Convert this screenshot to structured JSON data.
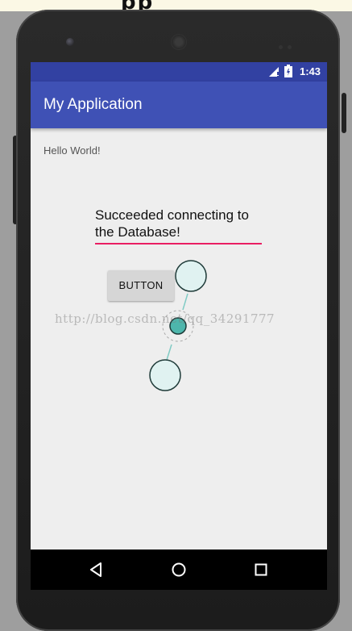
{
  "status_bar": {
    "time": "1:43",
    "icons": [
      "signal-icon",
      "battery-icon"
    ]
  },
  "app_bar": {
    "title": "My Application"
  },
  "content": {
    "hello_text": "Hello World!",
    "edit_text_value": "Succeeded connecting to the Database!",
    "button_label": "BUTTON"
  },
  "watermark": "http://blog.csdn.net/qq_34291777",
  "nav_bar": {
    "icons": [
      "back-icon",
      "home-icon",
      "recents-icon"
    ]
  },
  "colors": {
    "status_bar": "#3241a2",
    "app_bar": "#3f51b5",
    "accent": "#e91e63",
    "screen_background": "#eeeeee",
    "selection_handle": "#80cbc4"
  }
}
